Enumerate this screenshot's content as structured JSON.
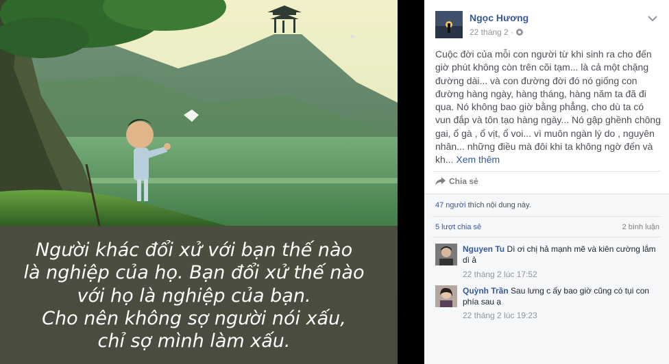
{
  "image": {
    "caption_lines": [
      "Người khác đổi xử với bạn thế nào",
      "là nghiệp của họ. Bạn đổi xử thế nào",
      "với họ là nghiệp của bạn.",
      "Cho nên không sợ người nói xấu,",
      "chỉ sợ mình làm xấu."
    ]
  },
  "post": {
    "author": "Ngọc Hương",
    "date": "22 tháng 2 ·",
    "body": "Cuộc đời của mỗi con người từ khi sinh ra cho đến giờ phút không còn trên cõi tạm... là cả một chặng đường dài... và con đường đời đó nó giống con đường hàng ngày, hàng tháng, hàng năm ta đã đi qua. Nó không bao giờ bằng phẳng, cho dù ta có vun đắp và tôn tạo hàng ngày... Nó gập ghềnh chông gai, ổ gà , ổ vịt, ổ voi... vì muôn ngàn lý do , nguyên nhân... những điều mà đôi khi ta không ngờ đến và kh...",
    "see_more": "Xem thêm",
    "share_label": "Chia sẻ",
    "likes_link": "47 người",
    "likes_text": " thích nội dung này.",
    "shares": "5 lượt chia sẻ",
    "comments_count": "2 bình luận"
  },
  "comments": [
    {
      "name": "Nguyen Tu",
      "text": " Dì ơi chị hả mạnh mẽ và kiên cường lắm dì ả",
      "time": "22 tháng 2 lúc 17:52"
    },
    {
      "name": "Quỳnh Trần",
      "text": " Sau lưng c ấy bao giờ cũng có tụi con phía sau ạ",
      "time": "22 tháng 2 lúc 19:23"
    }
  ],
  "colors": {
    "link": "#365899",
    "text": "#4b4f56",
    "meta": "#90949c",
    "panel_bg": "#ffffff",
    "footer_bg": "#f6f7f9"
  },
  "icons": {
    "privacy": "globe-icon",
    "menu": "chevron-down-icon",
    "share": "share-arrow-icon"
  }
}
